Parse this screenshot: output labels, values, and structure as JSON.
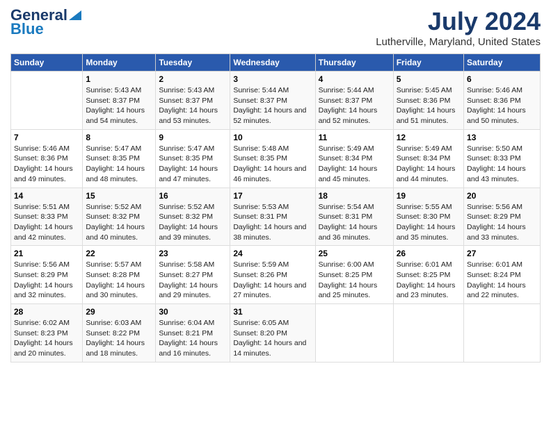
{
  "logo": {
    "line1": "General",
    "line2": "Blue"
  },
  "title": "July 2024",
  "subtitle": "Lutherville, Maryland, United States",
  "days_of_week": [
    "Sunday",
    "Monday",
    "Tuesday",
    "Wednesday",
    "Thursday",
    "Friday",
    "Saturday"
  ],
  "weeks": [
    [
      {
        "day": "",
        "info": ""
      },
      {
        "day": "1",
        "info": "Sunrise: 5:43 AM\nSunset: 8:37 PM\nDaylight: 14 hours\nand 54 minutes."
      },
      {
        "day": "2",
        "info": "Sunrise: 5:43 AM\nSunset: 8:37 PM\nDaylight: 14 hours\nand 53 minutes."
      },
      {
        "day": "3",
        "info": "Sunrise: 5:44 AM\nSunset: 8:37 PM\nDaylight: 14 hours\nand 52 minutes."
      },
      {
        "day": "4",
        "info": "Sunrise: 5:44 AM\nSunset: 8:37 PM\nDaylight: 14 hours\nand 52 minutes."
      },
      {
        "day": "5",
        "info": "Sunrise: 5:45 AM\nSunset: 8:36 PM\nDaylight: 14 hours\nand 51 minutes."
      },
      {
        "day": "6",
        "info": "Sunrise: 5:46 AM\nSunset: 8:36 PM\nDaylight: 14 hours\nand 50 minutes."
      }
    ],
    [
      {
        "day": "7",
        "info": "Sunrise: 5:46 AM\nSunset: 8:36 PM\nDaylight: 14 hours\nand 49 minutes."
      },
      {
        "day": "8",
        "info": "Sunrise: 5:47 AM\nSunset: 8:35 PM\nDaylight: 14 hours\nand 48 minutes."
      },
      {
        "day": "9",
        "info": "Sunrise: 5:47 AM\nSunset: 8:35 PM\nDaylight: 14 hours\nand 47 minutes."
      },
      {
        "day": "10",
        "info": "Sunrise: 5:48 AM\nSunset: 8:35 PM\nDaylight: 14 hours\nand 46 minutes."
      },
      {
        "day": "11",
        "info": "Sunrise: 5:49 AM\nSunset: 8:34 PM\nDaylight: 14 hours\nand 45 minutes."
      },
      {
        "day": "12",
        "info": "Sunrise: 5:49 AM\nSunset: 8:34 PM\nDaylight: 14 hours\nand 44 minutes."
      },
      {
        "day": "13",
        "info": "Sunrise: 5:50 AM\nSunset: 8:33 PM\nDaylight: 14 hours\nand 43 minutes."
      }
    ],
    [
      {
        "day": "14",
        "info": "Sunrise: 5:51 AM\nSunset: 8:33 PM\nDaylight: 14 hours\nand 42 minutes."
      },
      {
        "day": "15",
        "info": "Sunrise: 5:52 AM\nSunset: 8:32 PM\nDaylight: 14 hours\nand 40 minutes."
      },
      {
        "day": "16",
        "info": "Sunrise: 5:52 AM\nSunset: 8:32 PM\nDaylight: 14 hours\nand 39 minutes."
      },
      {
        "day": "17",
        "info": "Sunrise: 5:53 AM\nSunset: 8:31 PM\nDaylight: 14 hours\nand 38 minutes."
      },
      {
        "day": "18",
        "info": "Sunrise: 5:54 AM\nSunset: 8:31 PM\nDaylight: 14 hours\nand 36 minutes."
      },
      {
        "day": "19",
        "info": "Sunrise: 5:55 AM\nSunset: 8:30 PM\nDaylight: 14 hours\nand 35 minutes."
      },
      {
        "day": "20",
        "info": "Sunrise: 5:56 AM\nSunset: 8:29 PM\nDaylight: 14 hours\nand 33 minutes."
      }
    ],
    [
      {
        "day": "21",
        "info": "Sunrise: 5:56 AM\nSunset: 8:29 PM\nDaylight: 14 hours\nand 32 minutes."
      },
      {
        "day": "22",
        "info": "Sunrise: 5:57 AM\nSunset: 8:28 PM\nDaylight: 14 hours\nand 30 minutes."
      },
      {
        "day": "23",
        "info": "Sunrise: 5:58 AM\nSunset: 8:27 PM\nDaylight: 14 hours\nand 29 minutes."
      },
      {
        "day": "24",
        "info": "Sunrise: 5:59 AM\nSunset: 8:26 PM\nDaylight: 14 hours\nand 27 minutes."
      },
      {
        "day": "25",
        "info": "Sunrise: 6:00 AM\nSunset: 8:25 PM\nDaylight: 14 hours\nand 25 minutes."
      },
      {
        "day": "26",
        "info": "Sunrise: 6:01 AM\nSunset: 8:25 PM\nDaylight: 14 hours\nand 23 minutes."
      },
      {
        "day": "27",
        "info": "Sunrise: 6:01 AM\nSunset: 8:24 PM\nDaylight: 14 hours\nand 22 minutes."
      }
    ],
    [
      {
        "day": "28",
        "info": "Sunrise: 6:02 AM\nSunset: 8:23 PM\nDaylight: 14 hours\nand 20 minutes."
      },
      {
        "day": "29",
        "info": "Sunrise: 6:03 AM\nSunset: 8:22 PM\nDaylight: 14 hours\nand 18 minutes."
      },
      {
        "day": "30",
        "info": "Sunrise: 6:04 AM\nSunset: 8:21 PM\nDaylight: 14 hours\nand 16 minutes."
      },
      {
        "day": "31",
        "info": "Sunrise: 6:05 AM\nSunset: 8:20 PM\nDaylight: 14 hours\nand 14 minutes."
      },
      {
        "day": "",
        "info": ""
      },
      {
        "day": "",
        "info": ""
      },
      {
        "day": "",
        "info": ""
      }
    ]
  ]
}
